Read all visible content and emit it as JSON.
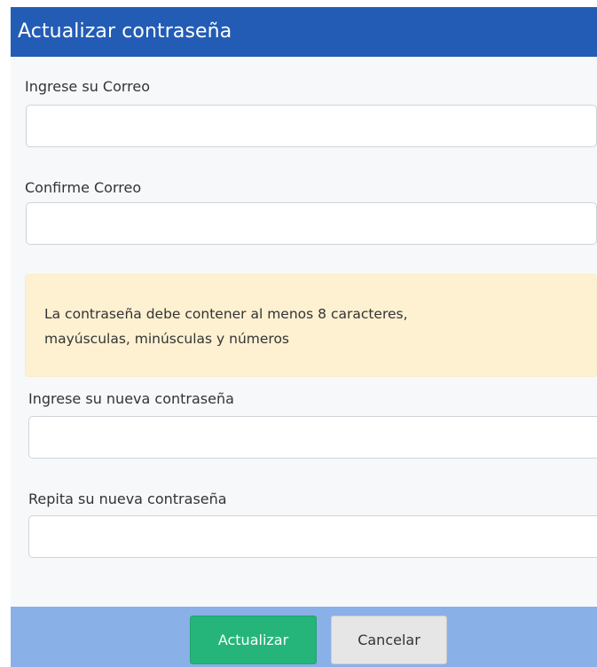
{
  "dialog": {
    "title": "Actualizar contraseña"
  },
  "form": {
    "email": {
      "label": "Ingrese su Correo",
      "value": "",
      "placeholder": ""
    },
    "email_confirm": {
      "label": "Confirme Correo",
      "value": "",
      "placeholder": ""
    },
    "notice": {
      "line1": "La contraseña debe contener al menos 8 caracteres,",
      "line2": "mayúsculas, minúsculas y números"
    },
    "new_password": {
      "label": "Ingrese su nueva contraseña",
      "value": "",
      "placeholder": ""
    },
    "repeat_password": {
      "label": "Repita su nueva contraseña",
      "value": "",
      "placeholder": ""
    }
  },
  "footer": {
    "update_label": "Actualizar",
    "cancel_label": "Cancelar"
  },
  "colors": {
    "header": "#235cb5",
    "footer": "#8ab0e8",
    "primary_button": "#25b57a",
    "warning_background": "#fdf1d2"
  }
}
